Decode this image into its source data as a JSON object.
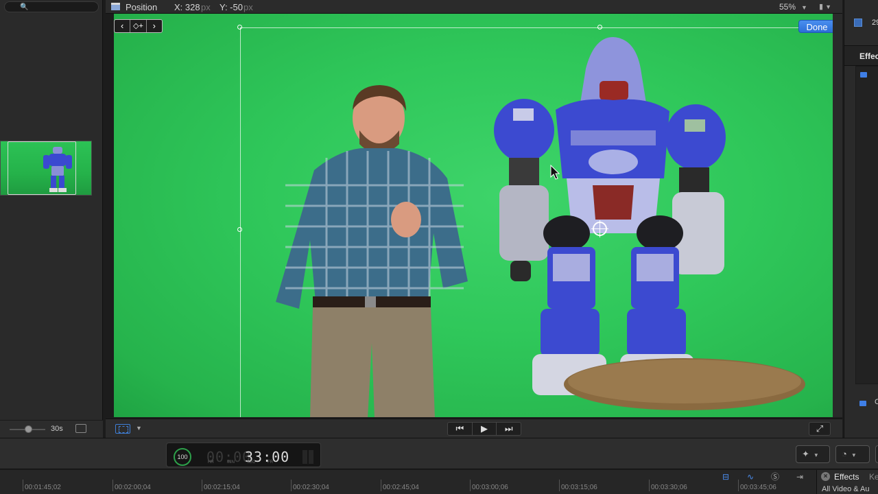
{
  "viewer": {
    "mode_label": "Position",
    "x_label": "X: 328",
    "x_unit": "px",
    "y_label": "Y: -50",
    "y_unit": "px",
    "zoom": "55%",
    "done_label": "Done",
    "keyframe_prev": "‹",
    "keyframe_add": "◇+",
    "keyframe_next": "›"
  },
  "browser": {
    "zoom_duration": "30s"
  },
  "inspector": {
    "frames_value": "29",
    "tab_label": "Effec",
    "bottom_label": "C"
  },
  "dashboard": {
    "percent": "100",
    "timecode_ghost": "00:00",
    "timecode": "33:00",
    "units": [
      "HR",
      "MIN",
      "SEC",
      "FR"
    ]
  },
  "timeline": {
    "ticks": [
      "00:01:45;02",
      "00:02:00;04",
      "00:02:15;04",
      "00:02:30;04",
      "00:02:45;04",
      "00:03:00;06",
      "00:03:15;06",
      "00:03:30;06",
      "00:03:45;06"
    ]
  },
  "effects_browser": {
    "title": "Effects",
    "tab2": "Ke",
    "category": "All Video & Au"
  },
  "colors": {
    "accent": "#3f7fe6",
    "green_screen": "#2fc75a",
    "done_button": "#2c6ed6"
  }
}
